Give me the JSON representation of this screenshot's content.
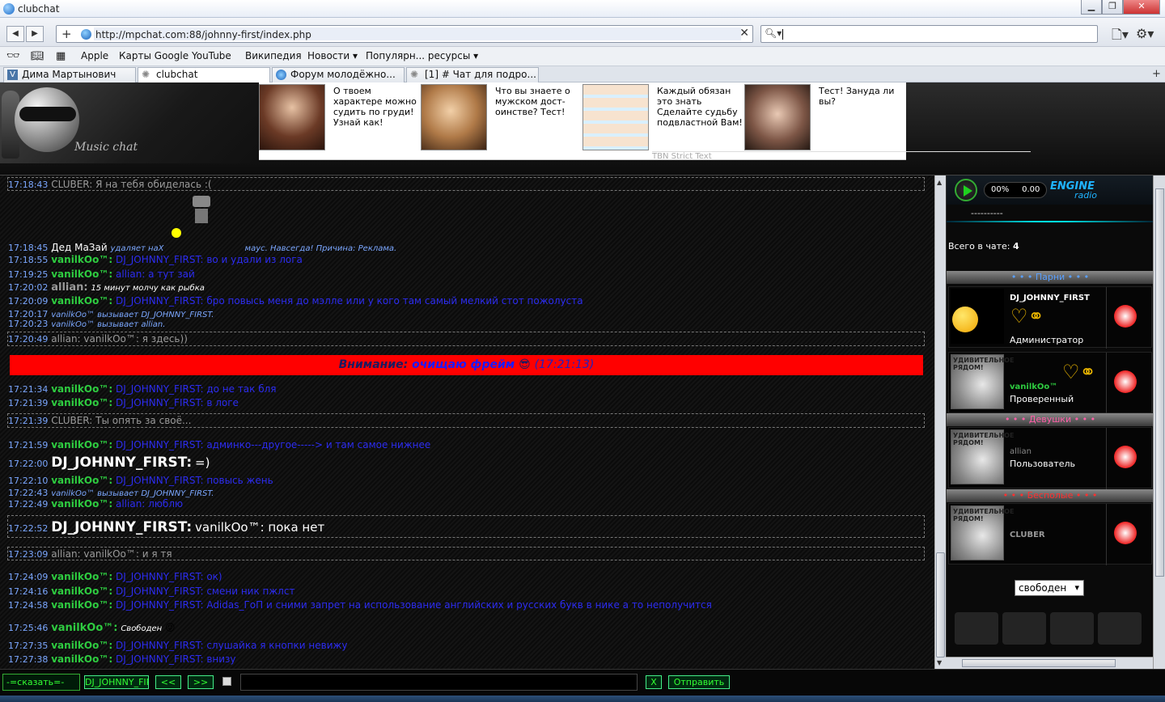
{
  "window": {
    "title": "clubchat",
    "min": "▁",
    "max": "❐",
    "close": "✕"
  },
  "nav": {
    "url": "http://mpchat.com:88/johnny-first/index.php",
    "search_value": ""
  },
  "bookmarks": [
    "Apple",
    "Карты Google",
    "YouTube",
    "Википедия",
    "Новости ▾",
    "Популярн... ресурсы ▾"
  ],
  "tabs": [
    {
      "label": "Дима Мартынович"
    },
    {
      "label": "clubchat"
    },
    {
      "label": "Форум молодёжно..."
    },
    {
      "label": "[1] # Чат для подро..."
    }
  ],
  "header": {
    "logo_text": "Music chat",
    "ads": [
      {
        "text": "О твоем характере можно судить по груди! Узнай как!"
      },
      {
        "text": "Что вы знаете о мужском дост-оинстве? Тест!"
      },
      {
        "text": "Каждый обязан это знать Сделайте судьбу подвластной Вам!"
      },
      {
        "text": "Тест! Зануда ли вы?"
      }
    ],
    "tbn": "TBN Strict Text"
  },
  "chat": {
    "lines": [
      {
        "time": "17:18:43",
        "nick": "CLUBER:",
        "text": "Я на тебя обиделась :("
      },
      {
        "time": "17:18:45",
        "nick": "Дед МаЗай",
        "text": "удаляет наХ",
        "text2": "маус. Навсегда! Причина: Реклама."
      },
      {
        "time": "17:18:55",
        "nick": "vanilkOo™:",
        "text": "DJ_JOHNNY_FIRST: во и удали из лога"
      },
      {
        "time": "17:19:25",
        "nick": "vanilkOo™:",
        "text": "allian: а тут зай"
      },
      {
        "time": "17:20:02",
        "nick": "allian:",
        "text": "15 минут молчу как рыбка"
      },
      {
        "time": "17:20:09",
        "nick": "vanilkOo™:",
        "text": "DJ_JOHNNY_FIRST: бро повысь меня до мэлле или у кого там самый мелкий стот пожолуста"
      },
      {
        "time": "17:20:17",
        "text": "vanilkOo™ вызывает DJ_JOHNNY_FIRST."
      },
      {
        "time": "17:20:23",
        "text": "vanilkOo™ вызывает allian."
      },
      {
        "time": "17:20:49",
        "nick": "allian:",
        "text": "vanilkOo™: я здесь))"
      },
      {
        "time": "17:21:34",
        "nick": "vanilkOo™:",
        "text": "DJ_JOHNNY_FIRST: до не так бля"
      },
      {
        "time": "17:21:39",
        "nick": "vanilkOo™:",
        "text": "DJ_JOHNNY_FIRST: в логе"
      },
      {
        "time": "17:21:39",
        "nick": "CLUBER:",
        "text": "Ты опять за своё..."
      },
      {
        "time": "17:21:59",
        "nick": "vanilkOo™:",
        "text": "DJ_JOHNNY_FIRST: админко---другое-----> и там самое нижнее"
      },
      {
        "time": "17:22:00",
        "nick": "DJ_JOHNNY_FIRST:",
        "text": "=)"
      },
      {
        "time": "17:22:10",
        "nick": "vanilkOo™:",
        "text": "DJ_JOHNNY_FIRST: повысь жень"
      },
      {
        "time": "17:22:43",
        "text": "vanilkOo™ вызывает DJ_JOHNNY_FIRST."
      },
      {
        "time": "17:22:49",
        "nick": "vanilkOo™:",
        "text": "allian: люблю"
      },
      {
        "time": "17:22:52",
        "nick": "DJ_JOHNNY_FIRST:",
        "text": "vanilkOo™: пока нет"
      },
      {
        "time": "17:23:09",
        "nick": "allian:",
        "text": "vanilkOo™: и я тя"
      },
      {
        "time": "17:24:09",
        "nick": "vanilkOo™:",
        "text": "DJ_JOHNNY_FIRST: ок)"
      },
      {
        "time": "17:24:16",
        "nick": "vanilkOo™:",
        "text": "DJ_JOHNNY_FIRST: смени ник пжлст"
      },
      {
        "time": "17:24:58",
        "nick": "vanilkOo™:",
        "text": "DJ_JOHNNY_FIRST: Adidas_ГоП и сними запрет на использование английских и русских букв в нике а то неполучится"
      },
      {
        "time": "17:25:46",
        "nick": "vanilkOo™:",
        "text": "Свободен"
      },
      {
        "time": "17:27:35",
        "nick": "vanilkOo™:",
        "text": "DJ_JOHNNY_FIRST: слушайка я кнопки невижу"
      },
      {
        "time": "17:27:38",
        "nick": "vanilkOo™:",
        "text": "DJ_JOHNNY_FIRST: внизу"
      }
    ],
    "alert": {
      "label": "Внимание:",
      "action": "очищаю фрейм",
      "time": "(17:21:13)"
    }
  },
  "sidebar": {
    "player": {
      "percent": "00%",
      "time": "0.00",
      "brand1": "ENGINE",
      "brand2": "radio",
      "track": "----------"
    },
    "total_label": "Всего в чате:",
    "total_count": "4",
    "sections": {
      "boys": "• • • Парни • • •",
      "girls": "• • • Девушки • • •",
      "free": "• • • Бесполые • • •"
    },
    "users": [
      {
        "name": "DJ_JOHNNY_FIRST",
        "role": "Администратор"
      },
      {
        "name": "vanilkOo™",
        "role": "Проверенный"
      },
      {
        "name": "allian",
        "role": "Пользователь"
      },
      {
        "name": "CLUBER",
        "role": ""
      }
    ],
    "avatar_text": "УДИВИТЕЛЬНОЕ РЯДОМ!",
    "status": "свободен"
  },
  "bottom": {
    "say": "-=сказать=-",
    "to": "DJ_JOHNNY_FIRST",
    "prev": "<<",
    "next": ">>",
    "clear": "X",
    "send": "Отправить"
  },
  "colors": {
    "alert_bg": "#ff0000",
    "time": "#7ba7ff",
    "nick_green": "#2ecc40",
    "text_blue": "#2c2cf0"
  }
}
